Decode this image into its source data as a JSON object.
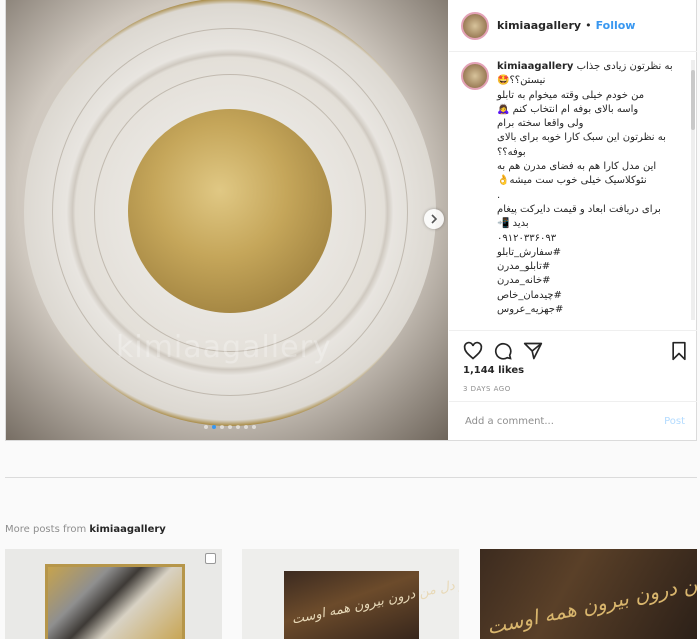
{
  "post": {
    "username": "kimiaagallery",
    "separator": "•",
    "follow_label": "Follow",
    "watermark": "kimiaagallery",
    "carousel_dots": 7,
    "caption_lines": [
      "به نظرتون زیادی جذاب",
      "نیستن؟؟🤩",
      "من خودم خیلی وقته میخوام به تابلو",
      "واسه بالای بوفه ام انتخاب کنم 🙇‍♀️",
      "ولی واقعا سخته برام",
      "به نظرتون این سبک کارا خوبه برای بالای",
      "بوفه؟؟",
      "این مدل کارا هم به فضای مدرن هم به",
      "نئوکلاسیک خیلی خوب ست میشه👌",
      ".",
      "برای دریافت ابعاد و قیمت دایرکت پیغام",
      "بدید 📲",
      "۰۹۱۲۰۳۳۶۰۹۳",
      "#سفارش_تابلو",
      "#تابلو_مدرن",
      "#خانه_مدرن",
      "#چیدمان_خاص",
      "#جهزیه_عروس"
    ],
    "likes": "1,144 likes",
    "time": "3 DAYS AGO",
    "comment_placeholder": "Add a comment...",
    "post_button": "Post"
  },
  "more": {
    "prefix": "More posts from ",
    "username": "kimiaagallery"
  },
  "thumbs": [
    {
      "callig": ""
    },
    {
      "callig": "اندر دل من درون بیرون همه اوست"
    },
    {
      "callig": "اندر دل من درون بیرون همه اوست"
    }
  ],
  "colors": {
    "link": "#3897f0",
    "muted": "#8e8e8e",
    "border": "#dbdbdb"
  }
}
